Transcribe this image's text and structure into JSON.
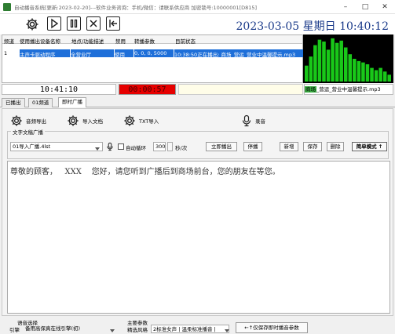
{
  "window": {
    "title": "自动播音系统[更新:2023-02-20]---软件业务咨询：手机/微信：请联系供应商  加密锁号:10000001[D815]",
    "minimize": "–",
    "maximize": "□",
    "close": "✕"
  },
  "toolbar": {
    "datetime": "2023-03-05  星期日  10:40:12"
  },
  "channel_grid": {
    "columns": [
      "频道",
      "使用播出设备名称",
      "地点/功能描述",
      "禁用",
      "转播参数",
      "目前状态"
    ],
    "rows": [
      [
        "1",
        "主声卡驱动程序",
        "全营业厅",
        "使用",
        "0, 0, 0, 5000",
        "10:38:50正在播出: 商场_营运_营业中温馨提示.mp3"
      ]
    ]
  },
  "status": {
    "clock": "10:41:10",
    "elapsed": "00:00:57",
    "now_playing_highlight": "商场",
    "now_playing_rest": "_营运_营业中温馨提示.mp3"
  },
  "tabs": [
    "已播出",
    "01频道",
    "即时广播"
  ],
  "panel": {
    "audio_out_label": "音频导出",
    "import_doc_label": "导入文档",
    "txt_import_label": "TXT导入",
    "record_label": "录音",
    "group_title": "文字文稿广播",
    "file_select": "01导入广播.4lst",
    "auto_loop_label": "自动循环",
    "loop_seconds": "300",
    "loop_unit": "秒/次",
    "play_now": "立即播出",
    "stop": "停播",
    "new": "新增",
    "save": "保存",
    "delete": "删除",
    "simple_mode": "简单模式 ↑",
    "text_content": "尊敬的顾客，   XXX    您好，请您听到广播后到商场前台，您的朋友在等您。"
  },
  "bottom": {
    "voice_select_title": "语音选择",
    "engine_label": "引擎",
    "engine_value": "备用高保真在线引擎(初)",
    "main_params_title": "主要参数",
    "style_label": "精选风格",
    "style_value": "2标准女声 | 温柔标准播音 |",
    "save_params": "←↑仅保存即时播音参数"
  },
  "meter_levels": [
    0.35,
    0.55,
    0.8,
    0.92,
    0.88,
    0.7,
    0.95,
    0.85,
    0.9,
    0.75,
    0.6,
    0.5,
    0.45,
    0.42,
    0.38,
    0.3,
    0.25,
    0.3,
    0.22,
    0.15
  ],
  "colors": {
    "accent": "#1e6fd9",
    "elapsed_bg": "#e60000",
    "meter_green": "#19c819",
    "date_color": "#1a3a8a"
  }
}
